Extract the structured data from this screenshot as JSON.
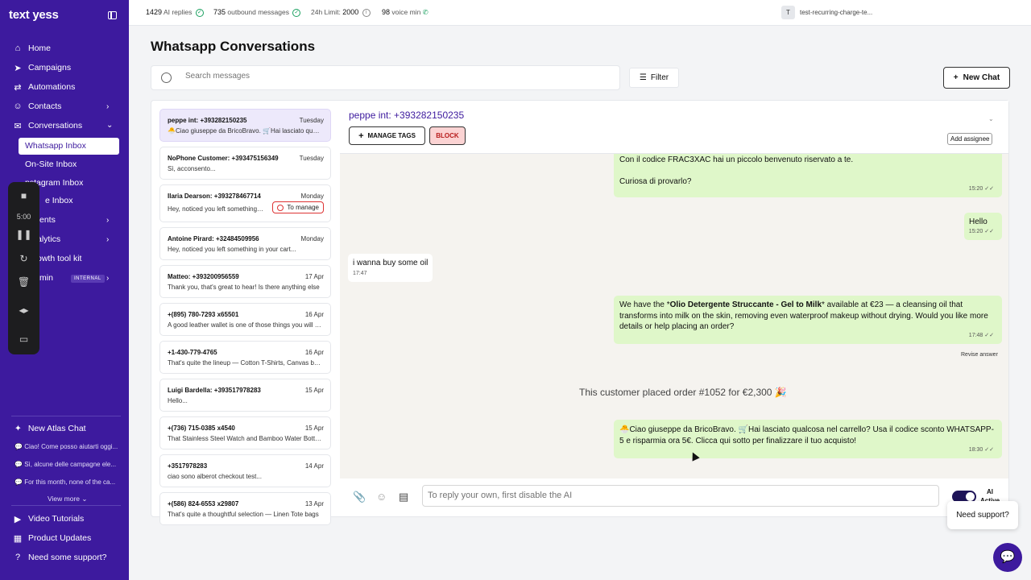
{
  "brand": {
    "logo": "text yess"
  },
  "sidebar": {
    "items": [
      {
        "label": "Home",
        "icon": "home-icon"
      },
      {
        "label": "Campaigns",
        "icon": "send-icon"
      },
      {
        "label": "Automations",
        "icon": "loop-icon"
      },
      {
        "label": "Contacts",
        "icon": "users-icon"
      },
      {
        "label": "Conversations",
        "icon": "mail-icon"
      }
    ],
    "sub_items": [
      "Whatsapp Inbox",
      "On-Site Inbox",
      "nstagram Inbox",
      "e Inbox"
    ],
    "partial_items": [
      "ents",
      "alytics",
      "owth tool kit",
      "min"
    ],
    "internal_badge": "INTERNAL",
    "atlas_label": "New Atlas Chat",
    "recent": [
      "Ciao! Come posso aiutarti oggi...",
      "Sì, alcune delle campagne ele...",
      "For this month, none of the ca..."
    ],
    "view_more": "View more",
    "footer": [
      "Video Tutorials",
      "Product Updates",
      "Need some support?"
    ],
    "toolbar_timer": "5:00"
  },
  "topbar": {
    "ai_replies_count": "1429",
    "ai_replies_label": "AI replies",
    "outbound_count": "735",
    "outbound_label": "outbound messages",
    "limit_label": "24h Limit:",
    "limit_value": "2000",
    "voice_count": "98",
    "voice_label": "voice min",
    "account_initial": "T",
    "account_name": "test-recurring-charge-te..."
  },
  "page": {
    "title": "Whatsapp Conversations",
    "search_placeholder": "Search messages",
    "filter_label": "Filter",
    "new_chat_label": "New Chat"
  },
  "conversations": [
    {
      "name": "peppe int: +393282150235",
      "date": "Tuesday",
      "preview": "🐣Ciao giuseppe da BricoBravo. 🛒Hai lasciato qualcosa nel carrello?",
      "selected": true
    },
    {
      "name": "NoPhone Customer: +393475156349",
      "date": "Tuesday",
      "preview": "Sì, acconsento..."
    },
    {
      "name": "Ilaria Dearson: +393278467714",
      "date": "Monday",
      "preview": "Hey, noticed you left something in your cart",
      "tag": "To manage"
    },
    {
      "name": "Antoine Pirard: +32484509956",
      "date": "Monday",
      "preview": "Hey, noticed you left something in your cart..."
    },
    {
      "name": "Matteo: +393200956559",
      "date": "17 Apr",
      "preview": "Thank you, that's great to hear! Is there anything else"
    },
    {
      "name": "+(895) 780-7293 x65501",
      "date": "16 Apr",
      "preview": "A good leather wallet is one of those things you will love"
    },
    {
      "name": "+1-430-779-4765",
      "date": "16 Apr",
      "preview": "That's quite the lineup — Cotton T-Shirts, Canvas bags"
    },
    {
      "name": "Luigi Bardella: +393517978283",
      "date": "15 Apr",
      "preview": "Hello..."
    },
    {
      "name": "+(736) 715-0385 x4540",
      "date": "15 Apr",
      "preview": "That Stainless Steel Watch and Bamboo Water Bottle are"
    },
    {
      "name": "+3517978283",
      "date": "14 Apr",
      "preview": "ciao sono alberot checkout test..."
    },
    {
      "name": "+(586) 824-6553 x29807",
      "date": "13 Apr",
      "preview": "That's quite a thoughtful selection — Linen Tote bags"
    }
  ],
  "chat": {
    "contact": "peppe int: +393282150235",
    "manage_tags": "MANAGE TAGS",
    "block": "BLOCK",
    "add_assignee": "Add assignee",
    "messages": [
      {
        "dir": "out",
        "line1": "Con il codice FRAC3XAC hai un piccolo benvenuto riservato a te.",
        "line2": "Curiosa di provarlo?",
        "time": "15:20 ✓✓"
      },
      {
        "dir": "out",
        "text": "Hello",
        "time": "15:20 ✓✓"
      },
      {
        "dir": "in",
        "text": "i wanna buy some oil",
        "time": "17:47"
      },
      {
        "dir": "out",
        "pre": "We have the *",
        "bold": "Olio Detergente Struccante - Gel to Milk",
        "post": "* available at €23 — a cleansing oil that transforms into milk on the skin, removing even waterproof makeup without drying. Would you like more details or help placing an order?",
        "time": "17:48 ✓✓"
      },
      {
        "dir": "out",
        "text": "🐣Ciao giuseppe da BricoBravo. 🛒Hai lasciato qualcosa nel carrello? Usa il codice sconto WHATSAPP-5 e risparmia ora 5€. Clicca qui sotto per finalizzare il tuo acquisto!",
        "time": "18:30 ✓✓"
      }
    ],
    "revise": "Revise answer",
    "system_note": "This customer placed order #1052 for €2,300 🎉",
    "reply_placeholder": "To reply your own, first disable the AI",
    "ai_label": "AI",
    "ai_state": "Active"
  },
  "support": {
    "bubble": "Need support?"
  }
}
